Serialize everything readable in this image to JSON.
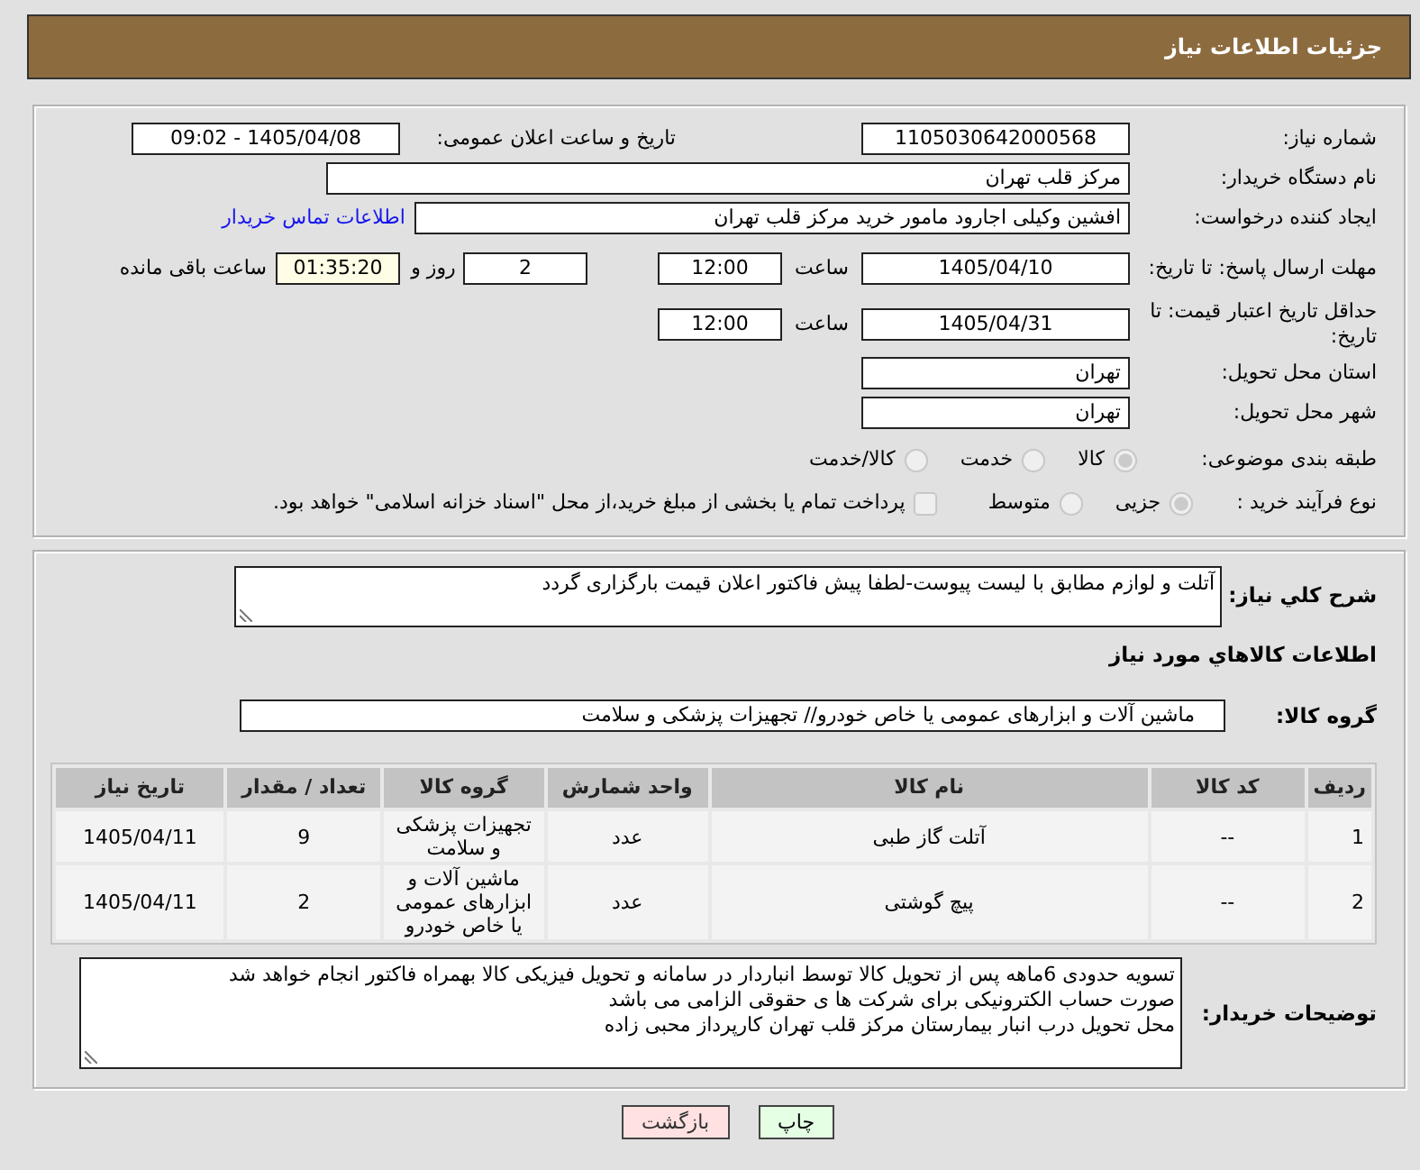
{
  "header": {
    "title": "جزئیات اطلاعات نیاز"
  },
  "need": {
    "number_label": "شماره نیاز:",
    "number": "1105030642000568",
    "announce_label": "تاریخ و ساعت اعلان عمومی:",
    "announce": "1405/04/08 - 09:02",
    "buyer_label": "نام دستگاه خریدار:",
    "buyer": "مرکز قلب تهران",
    "requester_label": "ایجاد کننده درخواست:",
    "requester": "افشین وکیلی اجارود مامور خرید مرکز قلب تهران",
    "contact_link": "اطلاعات تماس خریدار"
  },
  "deadline": {
    "label": "مهلت ارسال پاسخ: تا تاریخ:",
    "date": "1405/04/10",
    "time_label": "ساعت",
    "time": "12:00",
    "days": "2",
    "days_label": "روز و",
    "remaining": "01:35:20",
    "remaining_label": "ساعت باقی مانده"
  },
  "price_validity": {
    "label": "حداقل تاریخ اعتبار قیمت: تا تاریخ:",
    "date": "1405/04/31",
    "time_label": "ساعت",
    "time": "12:00"
  },
  "delivery": {
    "province_label": "استان محل تحویل:",
    "province": "تهران",
    "city_label": "شهر محل تحویل:",
    "city": "تهران"
  },
  "category": {
    "label": "طبقه بندی موضوعی:",
    "options": [
      {
        "label": "کالا",
        "selected": true
      },
      {
        "label": "خدمت",
        "selected": false
      },
      {
        "label": "کالا/خدمت",
        "selected": false
      }
    ]
  },
  "purchase_type": {
    "label": "نوع فرآیند خرید :",
    "options": [
      {
        "label": "جزیی",
        "selected": true
      },
      {
        "label": "متوسط",
        "selected": false
      }
    ],
    "treasury_payment": {
      "label": "پرداخت تمام یا بخشی از مبلغ خرید،از محل \"اسناد خزانه اسلامی\" خواهد بود.",
      "checked": false
    }
  },
  "description": {
    "label": "شرح کلي نياز:",
    "text": "آتلت و لوازم مطابق با لیست پیوست-لطفا پیش فاکتور اعلان قیمت بارگزاری گردد"
  },
  "items": {
    "title": "اطلاعات کالاهاي مورد نياز",
    "group_label": "گروه کالا:",
    "group": "ماشین آلات و ابزارهای عمومی یا خاص خودرو// تجهیزات پزشکی و سلامت",
    "table": {
      "columns": [
        "ردیف",
        "کد کالا",
        "نام کالا",
        "واحد شمارش",
        "گروه کالا",
        "تعداد / مقدار",
        "تاریخ نیاز"
      ],
      "rows": [
        [
          "1",
          "--",
          "آتلت گاز طبی",
          "عدد",
          "تجهیزات پزشکی و سلامت",
          "9",
          "1405/04/11"
        ],
        [
          "2",
          "--",
          "پیچ گوشتی",
          "عدد",
          "ماشین آلات و ابزارهای عمومی یا خاص خودرو",
          "2",
          "1405/04/11"
        ]
      ]
    }
  },
  "buyer_notes": {
    "label": "توضیحات خریدار:",
    "lines": [
      "تسویه حدودی 6ماهه پس از تحویل کالا توسط انباردار در سامانه و تحویل فیزیکی کالا بهمراه فاکتور انجام خواهد شد",
      "صورت حساب الکترونیکی برای شرکت ها ی حقوقی الزامی می باشد",
      "محل تحویل درب انبار بیمارستان مرکز قلب تهران کارپرداز محبی زاده"
    ]
  },
  "buttons": [
    {
      "label": "چاپ",
      "kind": "print"
    },
    {
      "label": "بازگشت",
      "kind": "back"
    }
  ]
}
